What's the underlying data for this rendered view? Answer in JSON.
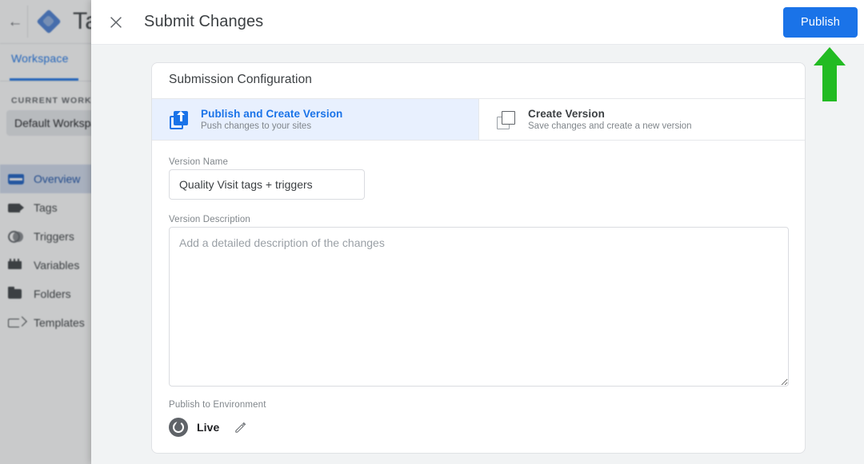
{
  "background_app": {
    "back_icon": "back-arrow-icon",
    "logo_icon": "tag-manager-logo",
    "brand": "Tag",
    "tab": "Workspace",
    "current_workspace_label": "CURRENT WORKSPACE",
    "current_workspace": "Default Workspace",
    "nav_items": [
      {
        "label": "Overview",
        "icon": "overview-icon",
        "selected": true
      },
      {
        "label": "Tags",
        "icon": "tag-icon",
        "selected": false
      },
      {
        "label": "Triggers",
        "icon": "trigger-icon",
        "selected": false
      },
      {
        "label": "Variables",
        "icon": "variables-icon",
        "selected": false
      },
      {
        "label": "Folders",
        "icon": "folder-icon",
        "selected": false
      },
      {
        "label": "Templates",
        "icon": "template-icon",
        "selected": false
      }
    ]
  },
  "modal": {
    "close_icon": "close-icon",
    "title": "Submit Changes",
    "publish_button": "Publish",
    "card": {
      "title": "Submission Configuration",
      "options": [
        {
          "title": "Publish and Create Version",
          "subtitle": "Push changes to your sites",
          "icon": "publish-and-create-version-icon",
          "selected": true
        },
        {
          "title": "Create Version",
          "subtitle": "Save changes and create a new version",
          "icon": "create-version-icon",
          "selected": false
        }
      ],
      "version_name": {
        "label": "Version Name",
        "value": "Quality Visit tags + triggers",
        "placeholder": ""
      },
      "version_description": {
        "label": "Version Description",
        "value": "",
        "placeholder": "Add a detailed description of the changes"
      },
      "environment": {
        "label": "Publish to Environment",
        "name": "Live",
        "avatar_icon": "environment-globe-icon",
        "edit_icon": "pencil-edit-icon"
      }
    }
  },
  "annotation": {
    "arrow_icon": "green-up-arrow-annotation",
    "color": "#22bb22"
  },
  "colors": {
    "accent_blue": "#1a73e8",
    "selected_option_bg": "#e8f0fe",
    "modal_bg": "#f1f3f4",
    "annotation_green": "#22bb22"
  }
}
